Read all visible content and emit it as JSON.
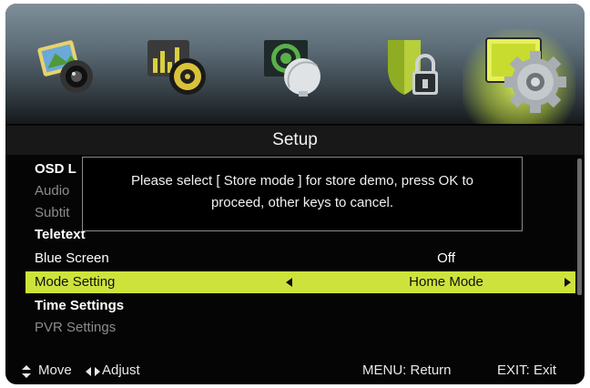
{
  "menu_icons": [
    {
      "name": "picture-icon"
    },
    {
      "name": "sound-icon"
    },
    {
      "name": "channel-icon"
    },
    {
      "name": "lock-icon"
    },
    {
      "name": "setup-gear-icon",
      "active": true
    }
  ],
  "colors": {
    "accent": "#cde33c",
    "background": "#050505",
    "dim_text": "#8c8c8c"
  },
  "title": "Setup",
  "rows": [
    {
      "label": "OSD L",
      "value": "",
      "state": "normal"
    },
    {
      "label": "Audio",
      "value": "",
      "state": "dim"
    },
    {
      "label": "Subtit",
      "value": "",
      "state": "dim"
    },
    {
      "label": "Teletext",
      "value": "",
      "state": "bold"
    },
    {
      "label": "Blue Screen",
      "value": "Off",
      "state": "normal"
    },
    {
      "label": "Mode Setting",
      "value": "Home Mode",
      "state": "selected"
    },
    {
      "label": "Time Settings",
      "value": "",
      "state": "bold"
    },
    {
      "label": "PVR Settings",
      "value": "",
      "state": "dim"
    }
  ],
  "dialog": {
    "line1": "Please select [ Store mode ] for store demo, press OK to",
    "line2": "proceed, other keys to cancel."
  },
  "footer": {
    "move": "Move",
    "adjust": "Adjust",
    "menu": "MENU: Return",
    "exit": "EXIT: Exit"
  }
}
